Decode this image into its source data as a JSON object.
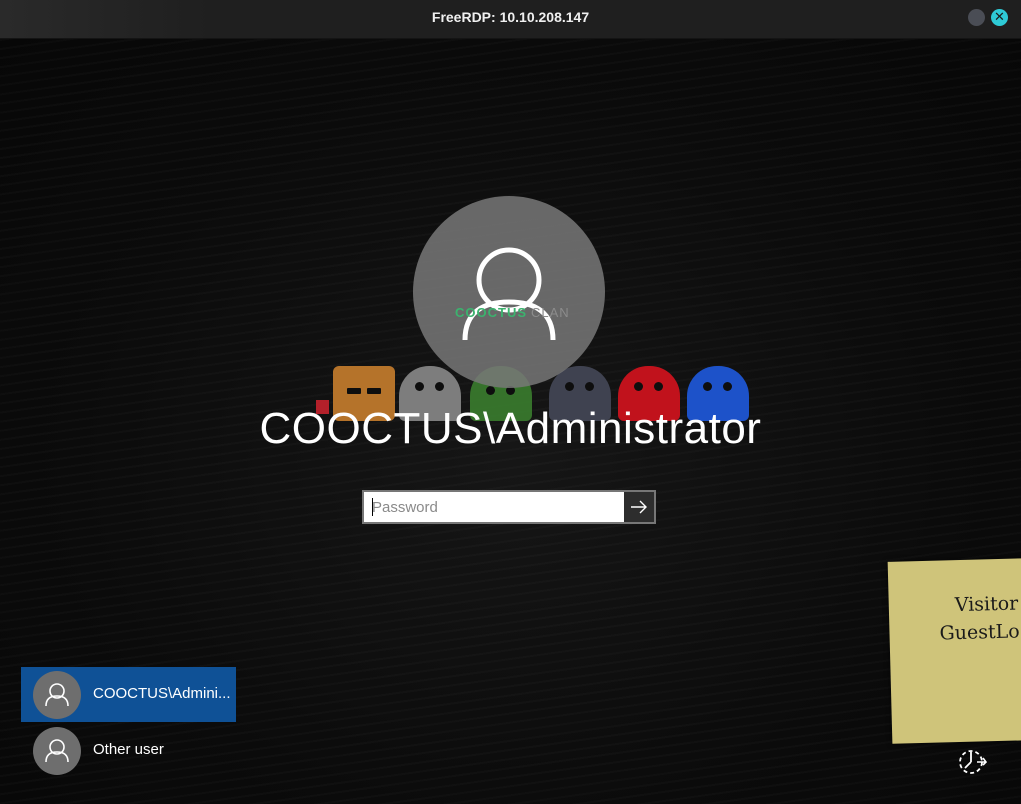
{
  "window": {
    "title": "FreeRDP: 10.10.208.147",
    "close_glyph": "✕"
  },
  "wallpaper": {
    "logo_primary": "COOCTUS",
    "logo_secondary": "CLAN"
  },
  "login": {
    "user_display": "COOCTUS\\Administrator",
    "password_placeholder": "Password",
    "submit_icon": "arrow-right-icon"
  },
  "sticky_note": {
    "line1": "Visitor",
    "line2": "GuestLo"
  },
  "user_list": [
    {
      "label": "COOCTUS\\Admini...",
      "selected": true
    },
    {
      "label": "Other user",
      "selected": false
    }
  ],
  "colors": {
    "selected_user_bg": "#0f5196",
    "close_button": "#2ecad6",
    "sticky_note": "#cfc47a"
  },
  "icons": [
    "user-avatar-icon",
    "arrow-right-icon",
    "ease-of-access-icon",
    "close-icon",
    "minimize-icon"
  ]
}
